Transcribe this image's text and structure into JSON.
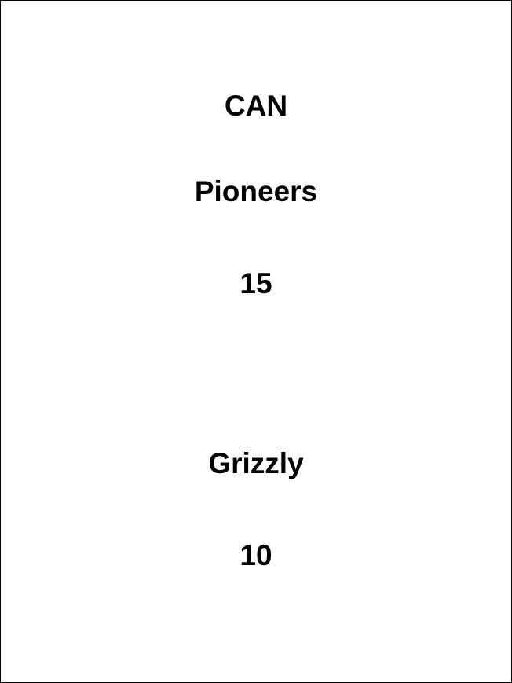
{
  "card": {
    "group": "CAN",
    "team1": {
      "name": "Pioneers",
      "score": "15"
    },
    "team2": {
      "name": "Grizzly",
      "score": "10"
    }
  },
  "colors": {
    "background": "#ffffff",
    "text": "#000000",
    "border": "#000000"
  }
}
